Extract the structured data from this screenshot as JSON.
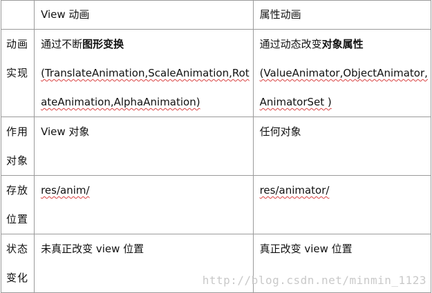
{
  "header": {
    "col0": "",
    "col1": "View 动画",
    "col2": "属性动画"
  },
  "rows": [
    {
      "label_line1": "动画",
      "label_line2": "实现",
      "view_prefix": "通过不断",
      "view_bold": "图形变换",
      "view_detail": "(TranslateAnimation,ScaleAnimation,RotateAnimation,AlphaAnimation)",
      "prop_prefix": "通过动态改变",
      "prop_bold": "对象属性",
      "prop_detail": "(ValueAnimator,ObjectAnimator,AnimatorSet )"
    },
    {
      "label_line1": "作用",
      "label_line2": "对象",
      "view_text": "View 对象",
      "prop_text": "任何对象"
    },
    {
      "label_line1": "存放",
      "label_line2": "位置",
      "view_text": "res/anim/",
      "prop_text": "res/animator/"
    },
    {
      "label_line1": "状态",
      "label_line2": "变化",
      "view_text": "未真正改变 view 位置",
      "prop_text": "真正改变 view 位置"
    }
  ],
  "watermark": "http://blog.csdn.net/minmin_1123"
}
